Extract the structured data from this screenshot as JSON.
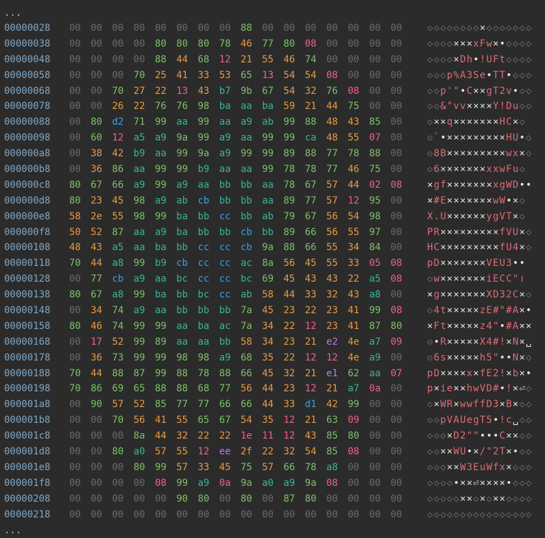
{
  "top_ellipsis": "...",
  "bottom_ellipsis": "...",
  "palette": {
    "offset": "#7fa7c6",
    "zero": "#6b6b6b",
    "ascii_text": "#e06c75",
    "control": "#e0e0e0",
    "green": "#7ec16a",
    "orange": "#e89b45",
    "red": "#e06c75",
    "pink": "#f0608a",
    "teal": "#38b59b",
    "blue": "#3d9ee0",
    "purple": "#b77ee0"
  },
  "rows": [
    {
      "offset": "00000028",
      "bytes": [
        "00",
        "00",
        "00",
        "00",
        "00",
        "00",
        "00",
        "00",
        "88",
        "00",
        "00",
        "00",
        "00",
        "00",
        "00",
        "00"
      ],
      "ascii": "◇◇◇◇◇◇◇◇×◇◇◇◇◇◇◇"
    },
    {
      "offset": "00000038",
      "bytes": [
        "00",
        "00",
        "00",
        "00",
        "80",
        "80",
        "80",
        "78",
        "46",
        "77",
        "80",
        "08",
        "00",
        "00",
        "00",
        "00"
      ],
      "ascii": "◇◇◇◇×××xFw×•◇◇◇◇"
    },
    {
      "offset": "00000048",
      "bytes": [
        "00",
        "00",
        "00",
        "00",
        "88",
        "44",
        "68",
        "12",
        "21",
        "55",
        "46",
        "74",
        "00",
        "00",
        "00",
        "00"
      ],
      "ascii": "◇◇◇◇×Dh•!UFt◇◇◇◇"
    },
    {
      "offset": "00000058",
      "bytes": [
        "00",
        "00",
        "00",
        "70",
        "25",
        "41",
        "33",
        "53",
        "65",
        "13",
        "54",
        "54",
        "08",
        "00",
        "00",
        "00"
      ],
      "ascii": "◇◇◇p%A3Se•TT•◇◇◇"
    },
    {
      "offset": "00000068",
      "bytes": [
        "00",
        "00",
        "70",
        "27",
        "22",
        "13",
        "43",
        "b7",
        "9b",
        "67",
        "54",
        "32",
        "76",
        "08",
        "00",
        "00"
      ],
      "ascii": "◇◇p'\"•C××gT2v•◇◇"
    },
    {
      "offset": "00000078",
      "bytes": [
        "00",
        "00",
        "26",
        "22",
        "76",
        "76",
        "98",
        "ba",
        "aa",
        "ba",
        "59",
        "21",
        "44",
        "75",
        "00",
        "00"
      ],
      "ascii": "◇◇&\"vv××××Y!Du◇◇"
    },
    {
      "offset": "00000088",
      "bytes": [
        "00",
        "80",
        "d2",
        "71",
        "99",
        "aa",
        "99",
        "aa",
        "a9",
        "ab",
        "99",
        "88",
        "48",
        "43",
        "85",
        "00"
      ],
      "ascii": "◇××q×××××××HC×◇"
    },
    {
      "offset": "00000098",
      "bytes": [
        "00",
        "60",
        "12",
        "a5",
        "a9",
        "9a",
        "99",
        "a9",
        "aa",
        "99",
        "99",
        "ca",
        "48",
        "55",
        "07",
        "00"
      ],
      "ascii": "◇`•×××××××××HU•◇"
    },
    {
      "offset": "000000a8",
      "bytes": [
        "00",
        "38",
        "42",
        "b9",
        "aa",
        "99",
        "9a",
        "a9",
        "99",
        "99",
        "89",
        "88",
        "77",
        "78",
        "88",
        "00"
      ],
      "ascii": "◇8B×××××××××wx×◇"
    },
    {
      "offset": "000000b8",
      "bytes": [
        "00",
        "36",
        "86",
        "aa",
        "99",
        "99",
        "b9",
        "aa",
        "aa",
        "99",
        "78",
        "78",
        "77",
        "46",
        "75",
        "00"
      ],
      "ascii": "◇6×××××××xxwFu◇"
    },
    {
      "offset": "000000c8",
      "bytes": [
        "80",
        "67",
        "66",
        "a9",
        "99",
        "a9",
        "aa",
        "bb",
        "bb",
        "aa",
        "78",
        "67",
        "57",
        "44",
        "02",
        "08"
      ],
      "ascii": "×gf×××××××xgWD••"
    },
    {
      "offset": "000000d8",
      "bytes": [
        "80",
        "23",
        "45",
        "98",
        "a9",
        "ab",
        "cb",
        "bb",
        "bb",
        "aa",
        "89",
        "77",
        "57",
        "12",
        "95",
        "00"
      ],
      "ascii": "×#E×××××××wW•×◇"
    },
    {
      "offset": "000000e8",
      "bytes": [
        "58",
        "2e",
        "55",
        "98",
        "99",
        "ba",
        "bb",
        "cc",
        "bb",
        "ab",
        "79",
        "67",
        "56",
        "54",
        "98",
        "00"
      ],
      "ascii": "X.U××××××ygVT×◇"
    },
    {
      "offset": "000000f8",
      "bytes": [
        "50",
        "52",
        "87",
        "aa",
        "a9",
        "ba",
        "bb",
        "bb",
        "cb",
        "bb",
        "89",
        "66",
        "56",
        "55",
        "97",
        "00"
      ],
      "ascii": "PR×××××××××fVU×◇"
    },
    {
      "offset": "00000108",
      "bytes": [
        "48",
        "43",
        "a5",
        "aa",
        "ba",
        "bb",
        "cc",
        "cc",
        "cb",
        "9a",
        "88",
        "66",
        "55",
        "34",
        "84",
        "00"
      ],
      "ascii": "HC×××××××××fU4×◇"
    },
    {
      "offset": "00000118",
      "bytes": [
        "70",
        "44",
        "a8",
        "99",
        "b9",
        "cb",
        "cc",
        "cc",
        "ac",
        "8a",
        "56",
        "45",
        "55",
        "33",
        "05",
        "08"
      ],
      "ascii": "pD×××××××VEU3••"
    },
    {
      "offset": "00000128",
      "bytes": [
        "00",
        "77",
        "cb",
        "a9",
        "aa",
        "bc",
        "cc",
        "cc",
        "bc",
        "69",
        "45",
        "43",
        "43",
        "22",
        "a5",
        "08"
      ],
      "ascii": "◇w×××××××iECC\"ו"
    },
    {
      "offset": "00000138",
      "bytes": [
        "80",
        "67",
        "a8",
        "99",
        "ba",
        "bb",
        "bc",
        "cc",
        "ab",
        "58",
        "44",
        "33",
        "32",
        "43",
        "a8",
        "00"
      ],
      "ascii": "×g×××××××XD32C×◇"
    },
    {
      "offset": "00000148",
      "bytes": [
        "00",
        "34",
        "74",
        "a9",
        "aa",
        "bb",
        "bb",
        "bb",
        "7a",
        "45",
        "23",
        "22",
        "23",
        "41",
        "99",
        "08"
      ],
      "ascii": "◇4t×××××zE#\"#A×•"
    },
    {
      "offset": "00000158",
      "bytes": [
        "80",
        "46",
        "74",
        "99",
        "99",
        "aa",
        "ba",
        "ac",
        "7a",
        "34",
        "22",
        "12",
        "23",
        "41",
        "87",
        "80"
      ],
      "ascii": "×Ft×××××z4\"•#A××"
    },
    {
      "offset": "00000168",
      "bytes": [
        "00",
        "17",
        "52",
        "99",
        "89",
        "aa",
        "aa",
        "bb",
        "58",
        "34",
        "23",
        "21",
        "e2",
        "4e",
        "a7",
        "09"
      ],
      "ascii": "◇•R×××××X4#!×N×␣"
    },
    {
      "offset": "00000178",
      "bytes": [
        "00",
        "36",
        "73",
        "99",
        "99",
        "98",
        "98",
        "a9",
        "68",
        "35",
        "22",
        "12",
        "12",
        "4e",
        "a9",
        "00"
      ],
      "ascii": "◇6s×××××h5\"••N×◇"
    },
    {
      "offset": "00000188",
      "bytes": [
        "70",
        "44",
        "88",
        "87",
        "99",
        "88",
        "78",
        "88",
        "66",
        "45",
        "32",
        "21",
        "e1",
        "62",
        "aa",
        "07"
      ],
      "ascii": "pD××××x×fE2!×b×•"
    },
    {
      "offset": "00000198",
      "bytes": [
        "70",
        "86",
        "69",
        "65",
        "88",
        "88",
        "68",
        "77",
        "56",
        "44",
        "23",
        "12",
        "21",
        "a7",
        "0a",
        "00"
      ],
      "ascii": "p×ie××hwVD#•!×⏎◇"
    },
    {
      "offset": "000001a8",
      "bytes": [
        "00",
        "90",
        "57",
        "52",
        "85",
        "77",
        "77",
        "66",
        "66",
        "44",
        "33",
        "d1",
        "42",
        "99",
        "00",
        "00"
      ],
      "ascii": "◇×WR×wwffD3×B×◇◇"
    },
    {
      "offset": "000001b8",
      "bytes": [
        "00",
        "00",
        "70",
        "56",
        "41",
        "55",
        "65",
        "67",
        "54",
        "35",
        "12",
        "21",
        "63",
        "09",
        "00",
        "00"
      ],
      "ascii": "◇◇pVAUegT5•!c␣◇◇"
    },
    {
      "offset": "000001c8",
      "bytes": [
        "00",
        "00",
        "00",
        "8a",
        "44",
        "32",
        "22",
        "22",
        "1e",
        "11",
        "12",
        "43",
        "85",
        "80",
        "00",
        "00"
      ],
      "ascii": "◇◇◇×D2\"\"•••C××◇◇"
    },
    {
      "offset": "000001d8",
      "bytes": [
        "00",
        "00",
        "80",
        "a0",
        "57",
        "55",
        "12",
        "ee",
        "2f",
        "22",
        "32",
        "54",
        "85",
        "08",
        "00",
        "00"
      ],
      "ascii": "◇◇××WU•×/\"2T×•◇◇"
    },
    {
      "offset": "000001e8",
      "bytes": [
        "00",
        "00",
        "00",
        "80",
        "99",
        "57",
        "33",
        "45",
        "75",
        "57",
        "66",
        "78",
        "a8",
        "00",
        "00",
        "00"
      ],
      "ascii": "◇◇◇××W3EuWfx×◇◇◇"
    },
    {
      "offset": "000001f8",
      "bytes": [
        "00",
        "00",
        "00",
        "00",
        "08",
        "99",
        "a9",
        "0a",
        "9a",
        "a0",
        "a9",
        "9a",
        "08",
        "00",
        "00",
        "00"
      ],
      "ascii": "◇◇◇◇•××⏎××××•◇◇◇"
    },
    {
      "offset": "00000208",
      "bytes": [
        "00",
        "00",
        "00",
        "00",
        "00",
        "90",
        "80",
        "00",
        "80",
        "00",
        "87",
        "80",
        "00",
        "00",
        "00",
        "00"
      ],
      "ascii": "◇◇◇◇◇××◇×◇××◇◇◇◇"
    },
    {
      "offset": "00000218",
      "bytes": [
        "00",
        "00",
        "00",
        "00",
        "00",
        "00",
        "00",
        "00",
        "00",
        "00",
        "00",
        "00",
        "00",
        "00",
        "00",
        "00"
      ],
      "ascii": "◇◇◇◇◇◇◇◇◇◇◇◇◇◇◇◇"
    }
  ]
}
